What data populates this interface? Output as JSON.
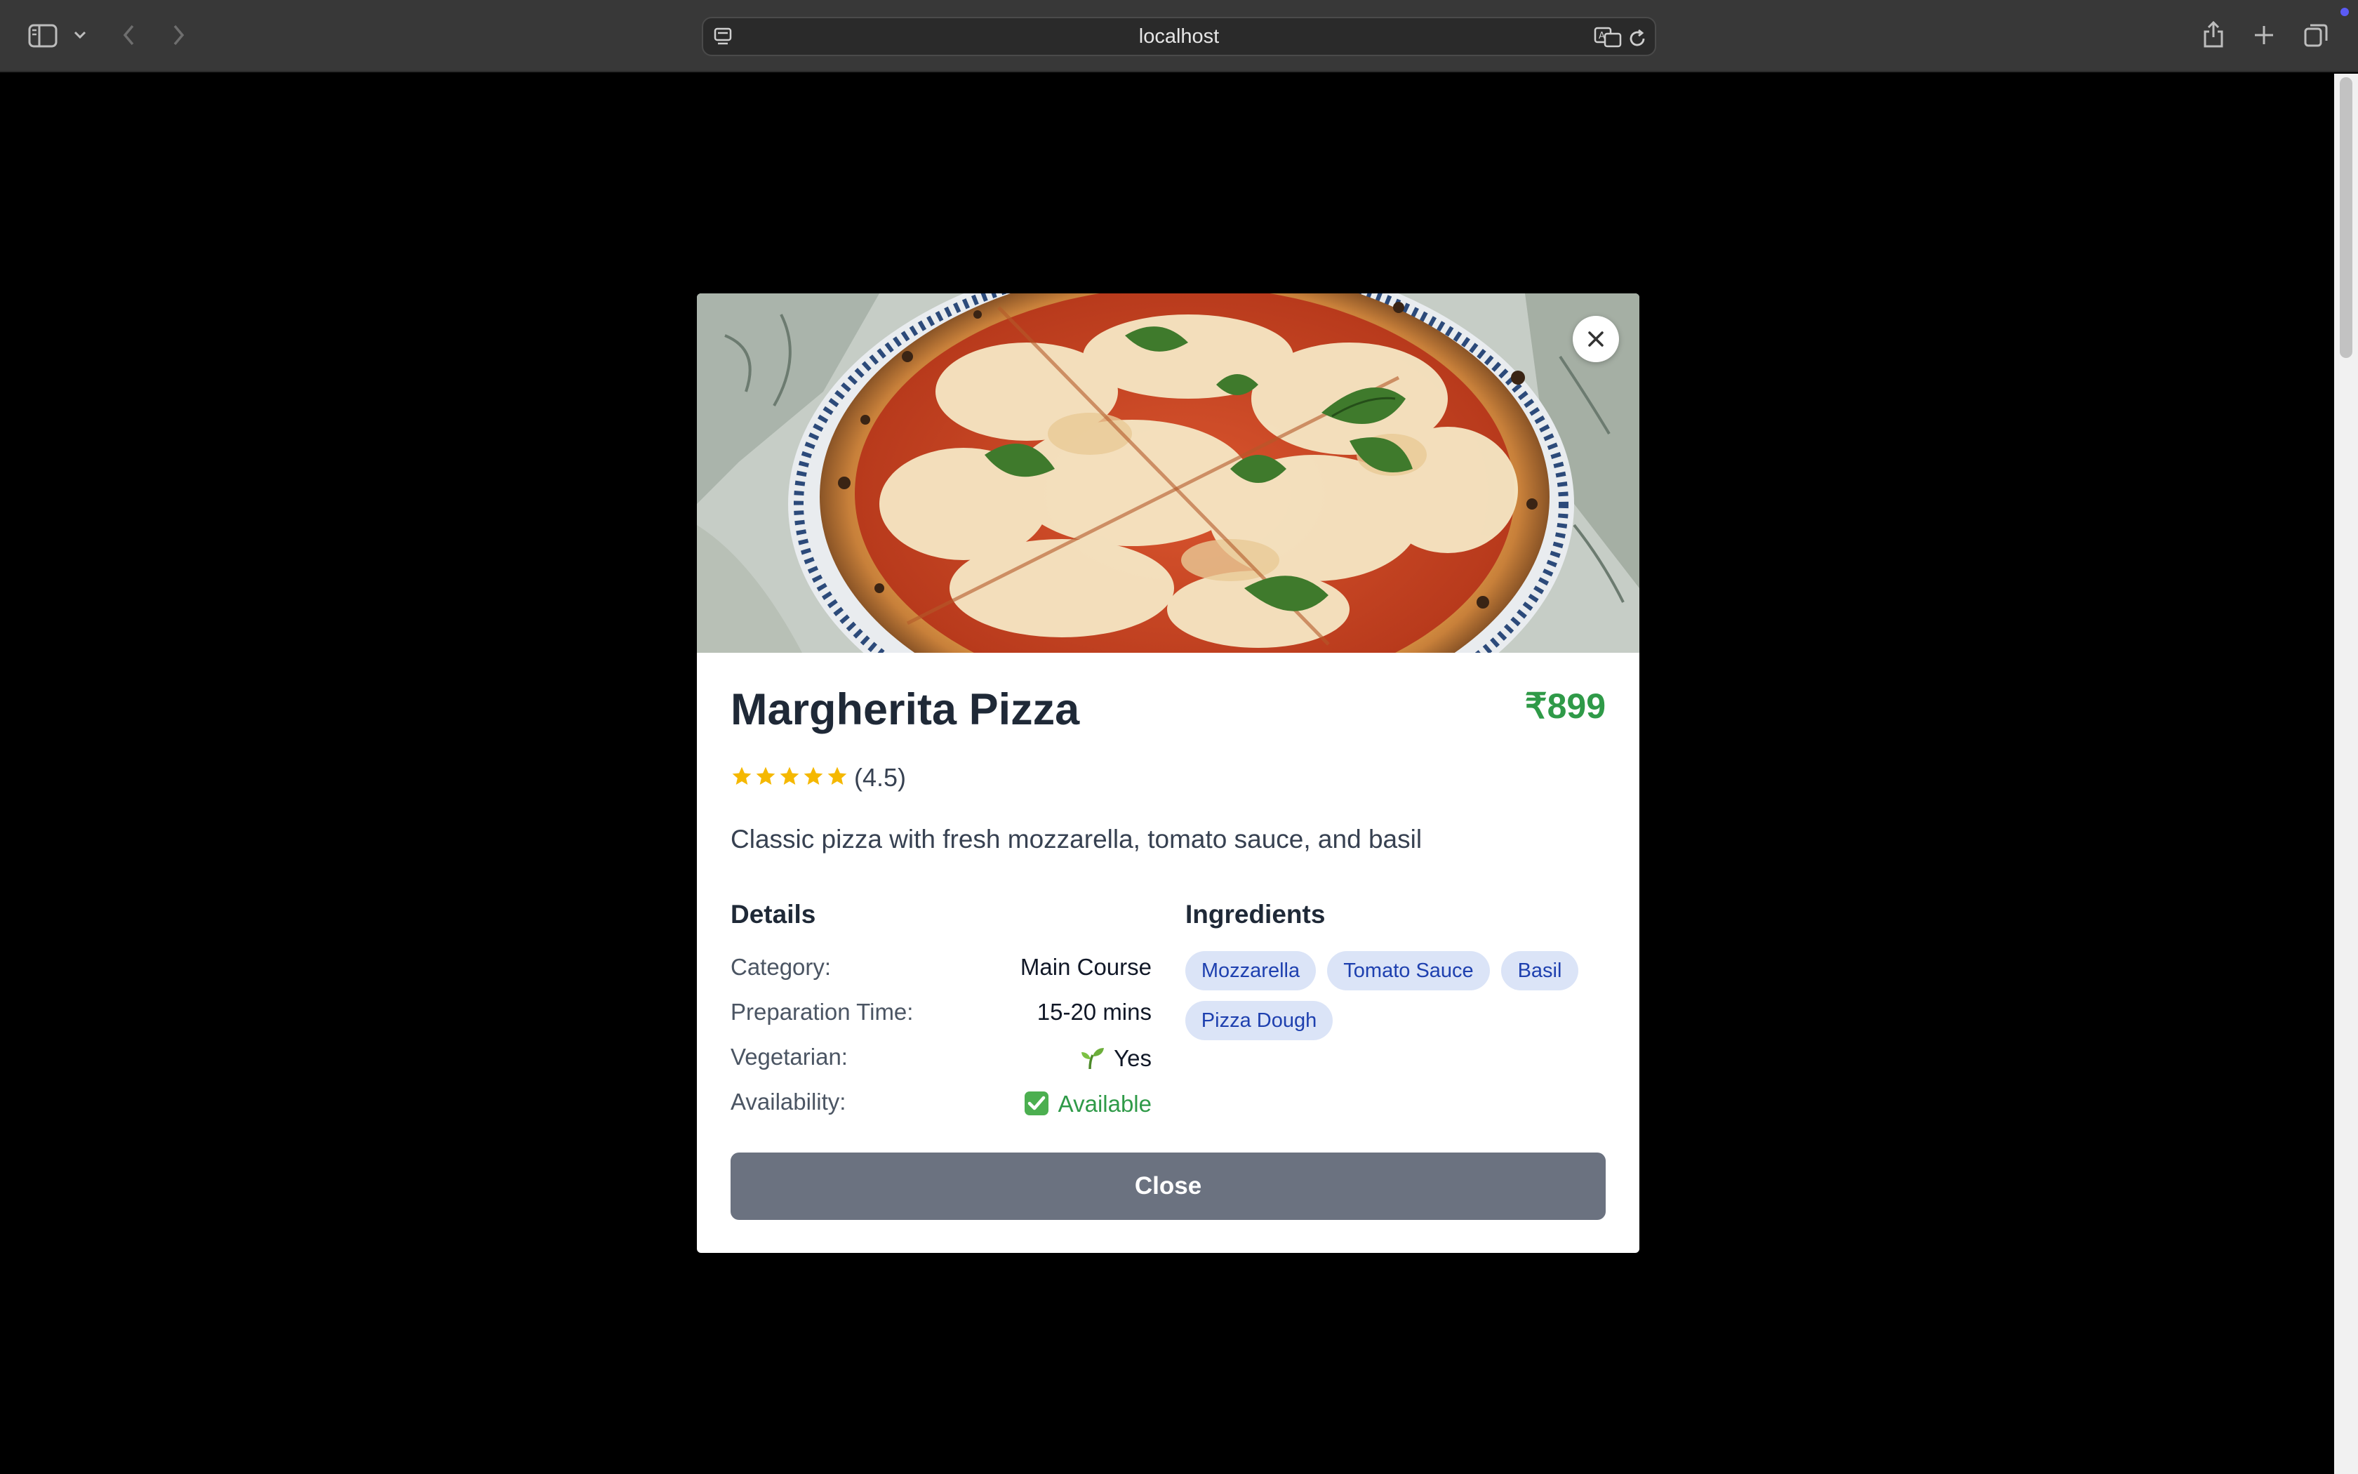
{
  "browser": {
    "url": "localhost"
  },
  "item": {
    "name": "Margherita Pizza",
    "price": "₹899",
    "rating_value": 4.5,
    "rating_text": "(4.5)",
    "description": "Classic pizza with fresh mozzarella, tomato sauce, and basil",
    "image_alt": "Margherita pizza with basil leaves"
  },
  "details": {
    "heading": "Details",
    "rows": [
      {
        "label": "Category:",
        "value": "Main Course"
      },
      {
        "label": "Preparation Time:",
        "value": "15-20 mins"
      },
      {
        "label": "Vegetarian:",
        "value": "Yes",
        "icon": "seedling-icon"
      },
      {
        "label": "Availability:",
        "value": "Available",
        "icon": "check-box-icon"
      }
    ]
  },
  "ingredients": {
    "heading": "Ingredients",
    "items": [
      "Mozzarella",
      "Tomato Sauce",
      "Basil",
      "Pizza Dough"
    ]
  },
  "actions": {
    "close_label": "Close"
  },
  "colors": {
    "price": "#2f9a48",
    "available": "#2f9a48",
    "chip_bg": "#dbe4f7",
    "chip_text": "#1e40af",
    "close_button": "#6b7280",
    "star": "#f5b800"
  }
}
